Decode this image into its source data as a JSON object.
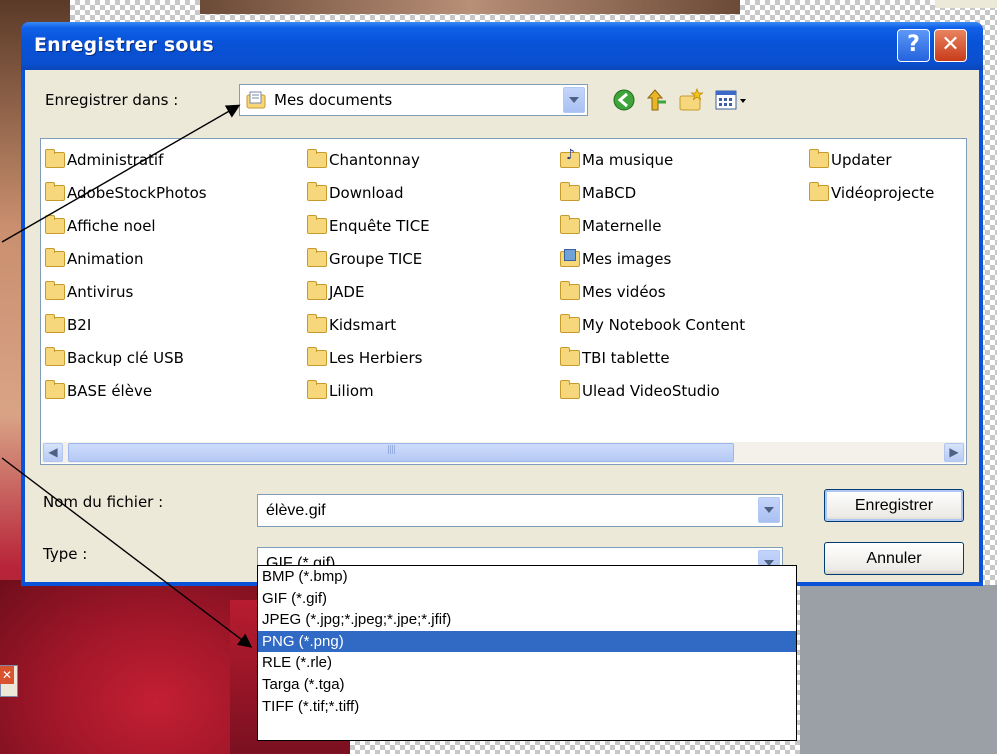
{
  "dialog": {
    "title": "Enregistrer sous",
    "help_glyph": "?",
    "close_glyph": "✕"
  },
  "save_in": {
    "label": "Enregistrer dans :",
    "value": "Mes documents"
  },
  "files": {
    "columns": [
      [
        {
          "name": "Administratif",
          "icon": "folder-icon"
        },
        {
          "name": "AdobeStockPhotos",
          "icon": "folder-icon"
        },
        {
          "name": "Affiche noel",
          "icon": "folder-icon"
        },
        {
          "name": "Animation",
          "icon": "folder-icon"
        },
        {
          "name": "Antivirus",
          "icon": "folder-icon"
        },
        {
          "name": "B2I",
          "icon": "folder-icon"
        },
        {
          "name": "Backup clé USB",
          "icon": "folder-icon"
        },
        {
          "name": "BASE élève",
          "icon": "folder-icon"
        }
      ],
      [
        {
          "name": "Chantonnay",
          "icon": "folder-icon"
        },
        {
          "name": "Download",
          "icon": "folder-icon"
        },
        {
          "name": "Enquête TICE",
          "icon": "folder-icon"
        },
        {
          "name": "Groupe TICE",
          "icon": "folder-icon"
        },
        {
          "name": "JADE",
          "icon": "folder-icon"
        },
        {
          "name": "Kidsmart",
          "icon": "folder-icon"
        },
        {
          "name": "Les Herbiers",
          "icon": "folder-icon"
        },
        {
          "name": "Liliom",
          "icon": "folder-icon"
        }
      ],
      [
        {
          "name": "Ma musique",
          "icon": "music-folder-icon"
        },
        {
          "name": "MaBCD",
          "icon": "folder-icon"
        },
        {
          "name": "Maternelle",
          "icon": "folder-icon"
        },
        {
          "name": "Mes images",
          "icon": "pictures-folder-icon"
        },
        {
          "name": "Mes vidéos",
          "icon": "folder-icon"
        },
        {
          "name": "My Notebook Content",
          "icon": "folder-icon"
        },
        {
          "name": "TBI tablette",
          "icon": "folder-icon"
        },
        {
          "name": "Ulead VideoStudio",
          "icon": "folder-icon"
        }
      ],
      [
        {
          "name": "Updater",
          "icon": "folder-icon"
        },
        {
          "name": "Vidéoprojecte",
          "icon": "folder-icon"
        }
      ]
    ]
  },
  "filename": {
    "label": "Nom du fichier :",
    "value": "élève.gif"
  },
  "filetype": {
    "label": "Type :",
    "value": "GIF (*.gif)",
    "options": [
      "BMP (*.bmp)",
      "GIF (*.gif)",
      "JPEG (*.jpg;*.jpeg;*.jpe;*.jfif)",
      "PNG (*.png)",
      "RLE (*.rle)",
      "Targa (*.tga)",
      "TIFF (*.tif;*.tiff)"
    ],
    "highlighted_index": 3
  },
  "buttons": {
    "save": "Enregistrer",
    "cancel": "Annuler"
  },
  "scrollbar": {
    "left_glyph": "◀",
    "right_glyph": "▶"
  },
  "colors": {
    "title_bar": "#0a53d8",
    "selection": "#316ac5",
    "dialog_face": "#ece9d8"
  }
}
